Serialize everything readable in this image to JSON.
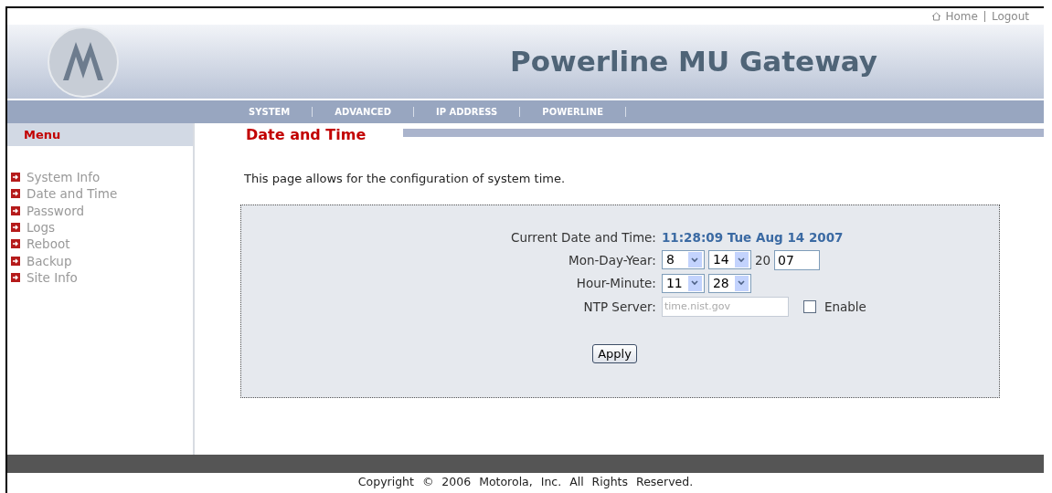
{
  "top_links": [
    {
      "label": "Home"
    },
    {
      "label": "Logout"
    }
  ],
  "header": {
    "title": "Powerline MU Gateway"
  },
  "nav": [
    {
      "label": "SYSTEM"
    },
    {
      "label": "ADVANCED"
    },
    {
      "label": "IP ADDRESS"
    },
    {
      "label": "POWERLINE"
    }
  ],
  "sidebar": {
    "title": "Menu",
    "items": [
      {
        "label": "System Info"
      },
      {
        "label": "Date and Time"
      },
      {
        "label": "Password"
      },
      {
        "label": "Logs"
      },
      {
        "label": "Reboot"
      },
      {
        "label": "Backup"
      },
      {
        "label": "Site Info"
      }
    ]
  },
  "content": {
    "title": "Date and Time",
    "description": "This page allows for the configuration of system time.",
    "current": {
      "label": "Current Date and Time:",
      "value": "11:28:09 Tue Aug 14 2007"
    },
    "date": {
      "label": "Mon-Day-Year:",
      "month": "8",
      "day": "14",
      "century": "20",
      "year": "07"
    },
    "time": {
      "label": "Hour-Minute:",
      "hour": "11",
      "minute": "28"
    },
    "ntp": {
      "label": "NTP Server:",
      "placeholder": "time.nist.gov",
      "enable": {
        "label": "Enable",
        "checked": false
      }
    },
    "apply": "Apply"
  },
  "footer": "Copyright © 2006 Motorola, Inc. All Rights Reserved."
}
